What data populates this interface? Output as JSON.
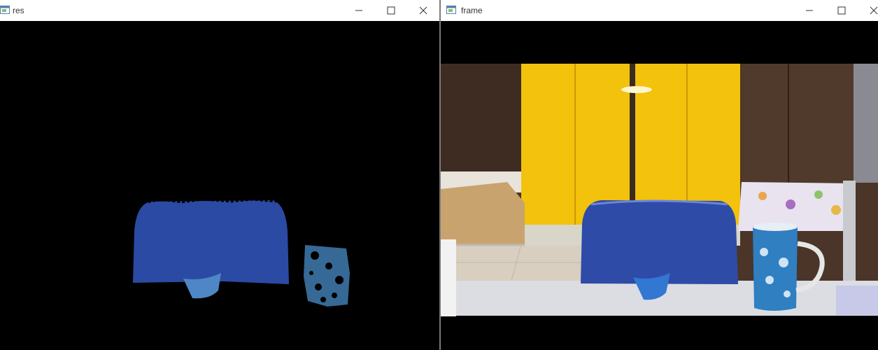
{
  "windows": [
    {
      "title": "res",
      "icons": {
        "app": "window-app-icon",
        "minimize": "minimize-icon",
        "maximize": "maximize-icon",
        "close": "close-icon"
      }
    },
    {
      "title": "frame",
      "icons": {
        "app": "window-app-icon",
        "minimize": "minimize-icon",
        "maximize": "maximize-icon",
        "close": "close-icon"
      }
    }
  ],
  "colors": {
    "mask_blue": "#2b4aa3",
    "mask_cup": "#4f86c6",
    "cabinet_yellow": "#f2c20c",
    "cabinet_wall": "#4a3528",
    "chair_blue": "#2e4ba8",
    "desk": "#dcdde2",
    "mug_blue": "#2f7fc1"
  }
}
